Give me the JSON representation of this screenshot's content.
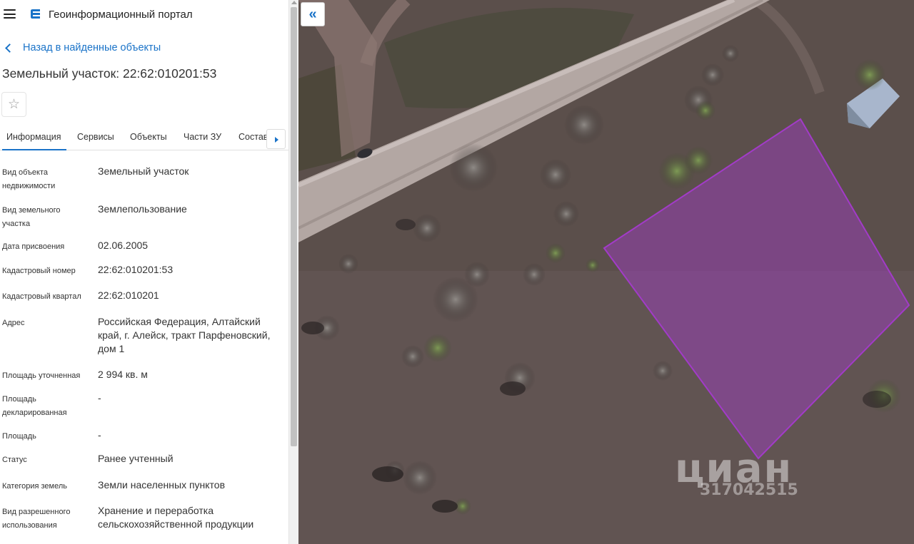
{
  "app": {
    "title": "Геоинформационный портал",
    "icons": {
      "menu": "menu-icon",
      "logo": "portal-logo-icon"
    }
  },
  "nav": {
    "back_label": "Назад в найденные объекты"
  },
  "object": {
    "title": "Земельный участок: 22:62:010201:53"
  },
  "favorite": {
    "glyph": "☆"
  },
  "tabs": [
    {
      "label": "Информация",
      "active": true
    },
    {
      "label": "Сервисы"
    },
    {
      "label": "Объекты"
    },
    {
      "label": "Части ЗУ"
    },
    {
      "label": "Состав"
    }
  ],
  "info": [
    {
      "label": "Вид объекта недвижимости",
      "value": "Земельный участок"
    },
    {
      "label": "Вид земельного участка",
      "value": "Землепользование"
    },
    {
      "label": "Дата присвоения",
      "value": "02.06.2005"
    },
    {
      "label": "Кадастровый номер",
      "value": "22:62:010201:53"
    },
    {
      "label": "Кадастровый квартал",
      "value": "22:62:010201"
    },
    {
      "label": "Адрес",
      "value": "Российская Федерация, Алтайский край, г. Алейск, тракт Парфеновский, дом 1"
    },
    {
      "label": "Площадь уточненная",
      "value": "2 994 кв. м"
    },
    {
      "label": "Площадь декларированная",
      "value": "-"
    },
    {
      "label": "Площадь",
      "value": "-"
    },
    {
      "label": "Статус",
      "value": "Ранее учтенный"
    },
    {
      "label": "Категория земель",
      "value": "Земли населенных пунктов"
    },
    {
      "label": "Вид разрешенного использования",
      "value": "Хранение и переработка сельскохозяйственной продукции"
    }
  ],
  "map": {
    "collapse_glyph": "«",
    "watermark": "циан",
    "watermark_id": "317042515",
    "parcel_color": "#a23bc8"
  }
}
